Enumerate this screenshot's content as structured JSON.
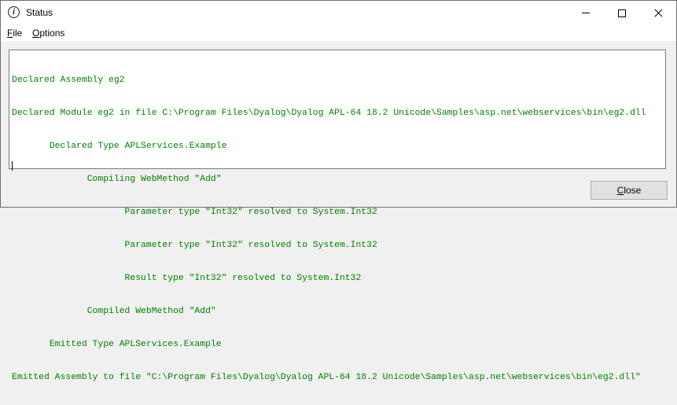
{
  "window": {
    "title": "Status",
    "title_icon": "info-icon",
    "controls": [
      "minimize-icon",
      "maximize-icon",
      "close-icon"
    ]
  },
  "menubar": {
    "file": {
      "mnemonic": "F",
      "rest": "ile"
    },
    "options": {
      "mnemonic": "O",
      "rest": "ptions"
    }
  },
  "log": {
    "text_color": "#008000",
    "lines": [
      "Declared Assembly eg2",
      "Declared Module eg2 in file C:\\Program Files\\Dyalog\\Dyalog APL-64 18.2 Unicode\\Samples\\asp.net\\webservices\\bin\\eg2.dll",
      "       Declared Type APLServices.Example",
      "              Compiling WebMethod \"Add\"",
      "                     Parameter type \"Int32\" resolved to System.Int32",
      "                     Parameter type \"Int32\" resolved to System.Int32",
      "                     Result type \"Int32\" resolved to System.Int32",
      "              Compiled WebMethod \"Add\"",
      "       Emitted Type APLServices.Example",
      "Emitted Assembly to file \"C:\\Program Files\\Dyalog\\Dyalog APL-64 18.2 Unicode\\Samples\\asp.net\\webservices\\bin\\eg2.dll\""
    ]
  },
  "footer": {
    "close_button": {
      "mnemonic": "C",
      "rest": "lose"
    }
  }
}
